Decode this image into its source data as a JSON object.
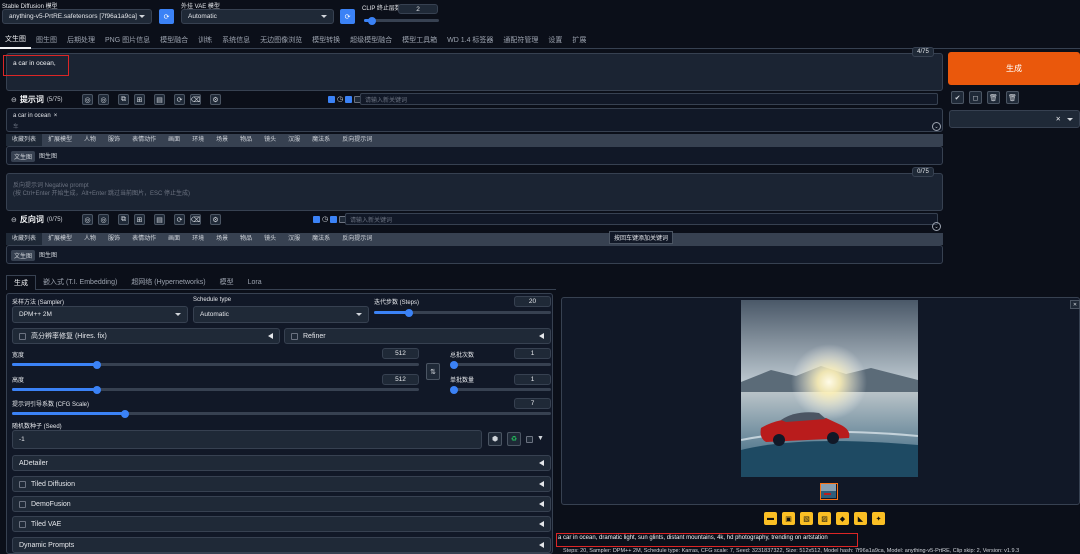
{
  "top": {
    "checkpoint_label": "Stable Diffusion 模型",
    "checkpoint_value": "anything-v5-PrtRE.safetensors [7f96a1a9ca]",
    "vae_label": "外挂 VAE 模型",
    "vae_value": "Automatic",
    "clip_label": "CLIP 终止层数",
    "clip_value": "2",
    "clip_level": 0.1
  },
  "tabs": [
    "文生图",
    "图生图",
    "后期处理",
    "PNG 图片信息",
    "模型融合",
    "训练",
    "系统信息",
    "无边图像浏览",
    "模型转换",
    "超级模型融合",
    "模型工具箱",
    "WD 1.4 标签器",
    "通配符管理",
    "设置",
    "扩展"
  ],
  "prompt": {
    "text": "a car in ocean,",
    "counter": "4/75",
    "generate_label": "生成",
    "section_label": "提示词",
    "section_count": "(5/75)",
    "keyword_placeholder": "请输入新关键词",
    "tag_text": "a car in ocean",
    "tag_close": "×",
    "tag_sub": "车"
  },
  "category_tabs": [
    "收藏列表",
    "扩展模型",
    "人物",
    "服饰",
    "表情动作",
    "画面",
    "环境",
    "场景",
    "物品",
    "镜头",
    "汉服",
    "魔法系",
    "反向提示词"
  ],
  "sub_tabs": [
    "文生图",
    "图生图"
  ],
  "negative": {
    "placeholder_line1": "反向提示词 Negative prompt",
    "placeholder_line2": "(按 Ctrl+Enter 开始生成，Alt+Enter 跳过当前图片，ESC 停止生成)",
    "counter": "0/75",
    "section_label": "反向词",
    "section_count": "(0/75)",
    "keyword_placeholder": "请输入新关键词",
    "tooltip": "按回车键添加关键词"
  },
  "gen_tabs": [
    "生成",
    "嵌入式 (T.I. Embedding)",
    "超网络 (Hypernetworks)",
    "模型",
    "Lora"
  ],
  "params": {
    "sampler_label": "采样方法 (Sampler)",
    "sampler_value": "DPM++ 2M",
    "schedule_label": "Schedule type",
    "schedule_value": "Automatic",
    "steps_label": "迭代步数 (Steps)",
    "steps_value": "20",
    "steps_level": 0.2,
    "hires_label": "高分辨率修复 (Hires. fix)",
    "refiner_label": "Refiner",
    "width_label": "宽度",
    "width_value": "512",
    "width_level": 0.21,
    "height_label": "高度",
    "height_value": "512",
    "height_level": 0.21,
    "swap_icon": "⇅",
    "batch_count_label": "总批次数",
    "batch_count_value": "1",
    "batch_size_label": "单批数量",
    "batch_size_value": "1",
    "cfg_label": "提示词引导系数 (CFG Scale)",
    "cfg_value": "7",
    "cfg_level": 0.21,
    "seed_label": "随机数种子 (Seed)",
    "seed_value": "-1"
  },
  "accordions": [
    "ADetailer",
    "Tiled Diffusion",
    "DemoFusion",
    "Tiled VAE",
    "Dynamic Prompts"
  ],
  "output": {
    "prompt_text": "a car in ocean, dramatic light, sun glints, distant mountains, 4k, hd photography, trending on artstation",
    "info_text": "Steps: 20, Sampler: DPM++ 2M, Schedule type: Karras, CFG scale: 7, Seed: 3231837322, Size: 512x512, Model hash: 7f96a1a9ca, Model: anything-v5-PrtRE, Clip skip: 2, Version: v1.9.3"
  },
  "icons": {
    "refresh": "refresh-icon",
    "trash": "trash-icon",
    "check": "check-icon",
    "folder": "folder-icon",
    "save": "save-icon"
  },
  "colors": {
    "generate": "#ea580c",
    "accent": "#3b82f6",
    "highlight": "#dc2626"
  }
}
